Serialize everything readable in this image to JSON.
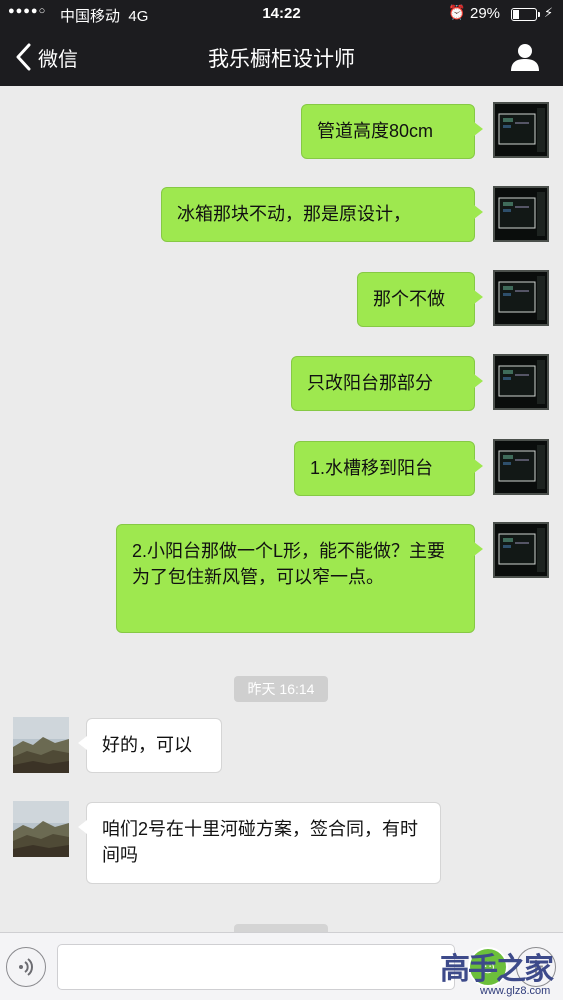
{
  "status_bar": {
    "signal": "●●●●○",
    "carrier": "中国移动",
    "network": "4G",
    "time": "14:22",
    "battery_pct": "29%",
    "battery_level": 0.29
  },
  "nav": {
    "back_label": "微信",
    "title": "我乐橱柜设计师"
  },
  "messages_out": [
    {
      "text": "管道高度80cm"
    },
    {
      "text": "冰箱那块不动，那是原设计，"
    },
    {
      "text": "那个不做"
    },
    {
      "text": "只改阳台那部分"
    },
    {
      "text": "1.水槽移到阳台"
    },
    {
      "text": "2.小阳台那做一个L形，能不能做？主要为了包住新风管，可以窄一点。"
    }
  ],
  "time_divider": "昨天 16:14",
  "messages_in": [
    {
      "text": "好的，可以"
    },
    {
      "text": "咱们2号在十里河碰方案，签合同，有时间吗"
    }
  ],
  "input": {
    "placeholder": ""
  },
  "watermark": {
    "logo_text": "高手之家",
    "url": "www.glz8.com"
  },
  "colors": {
    "header_bg": "#1c1c1f",
    "chat_bg": "#ebebeb",
    "bubble_out": "#9ee84f",
    "bubble_in": "#ffffff"
  }
}
